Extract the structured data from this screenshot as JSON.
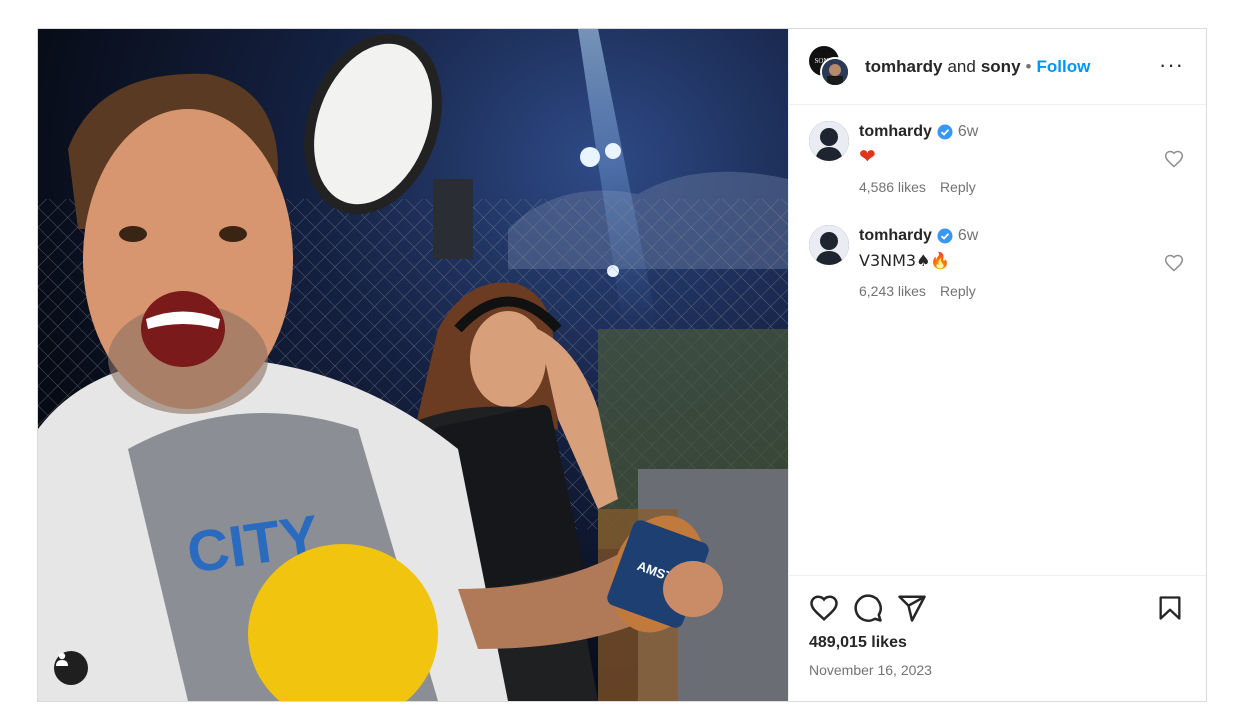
{
  "header": {
    "user1": "tomhardy",
    "and_text": "and",
    "user2": "sony",
    "dot": "•",
    "follow_label": "Follow",
    "avatar_a_text": "SONY",
    "more_label": "···"
  },
  "comments": [
    {
      "user": "tomhardy",
      "time": "6w",
      "text": "❤",
      "likes": "4,586 likes",
      "reply": "Reply"
    },
    {
      "user": "tomhardy",
      "time": "6w",
      "text": "V3NM3♠🔥",
      "likes": "6,243 likes",
      "reply": "Reply"
    }
  ],
  "post": {
    "likes": "489,015 likes",
    "date": "November 16, 2023"
  },
  "photo": {
    "can_text": "AMSTEL"
  },
  "colors": {
    "accent": "#0095f6",
    "muted": "#737373",
    "verified": "#3897f0",
    "heart": "#ed4956"
  }
}
